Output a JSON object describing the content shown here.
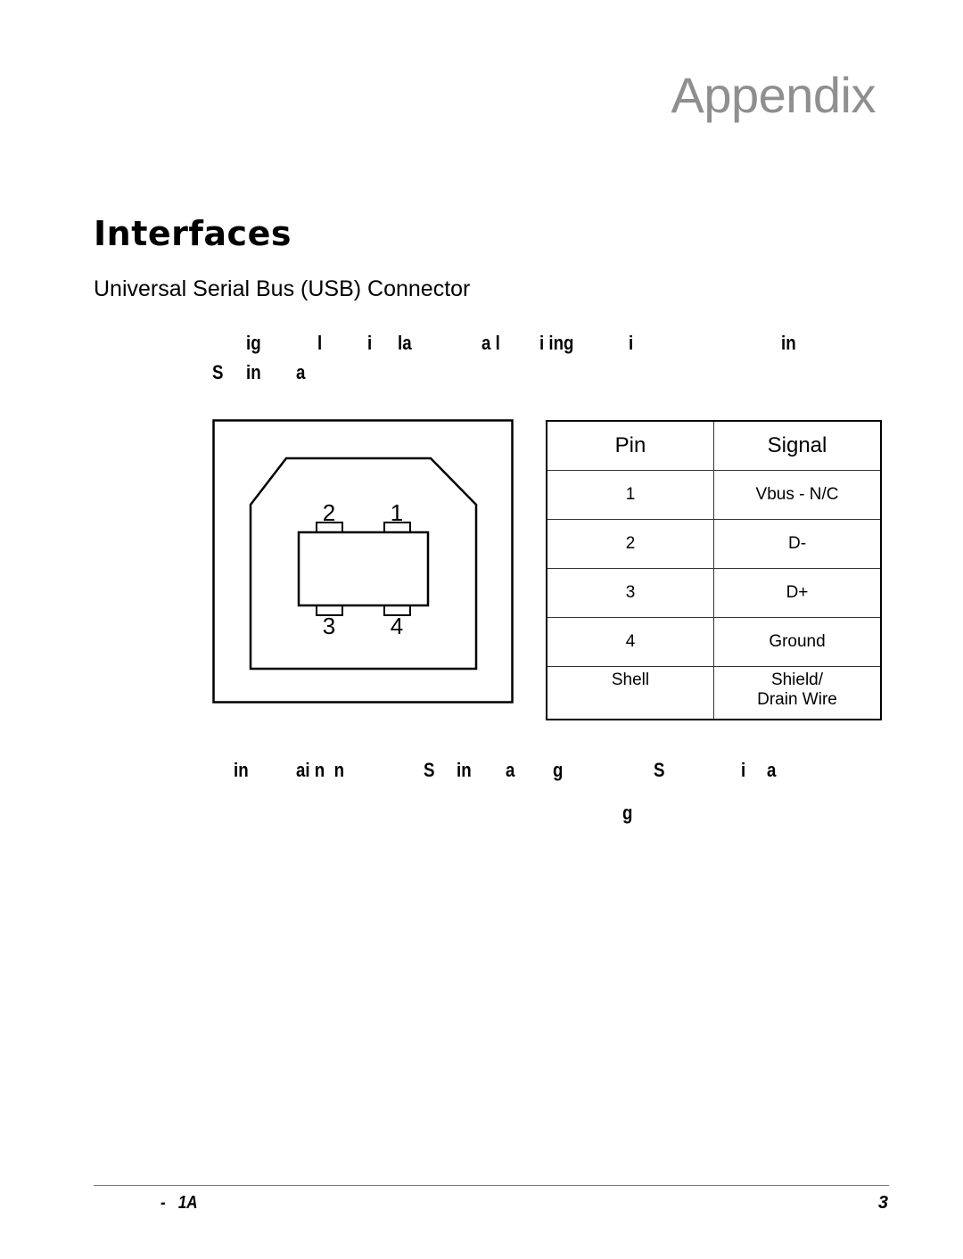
{
  "header": {
    "chapter_title": "Appendix"
  },
  "section": {
    "title": "Interfaces",
    "subtitle": "Universal Serial Bus (USB) Connector"
  },
  "intro_fragments": {
    "line1": [
      "ig",
      "l",
      "i",
      "la",
      "a l",
      "i ing",
      "i",
      "in"
    ],
    "line2": [
      "S",
      "in",
      "a"
    ]
  },
  "diagram": {
    "pin_labels": [
      "2",
      "1",
      "3",
      "4"
    ]
  },
  "pin_table": {
    "headers": [
      "Pin",
      "Signal"
    ],
    "rows": [
      {
        "pin": "1",
        "signal": "Vbus - N/C"
      },
      {
        "pin": "2",
        "signal": "D-"
      },
      {
        "pin": "3",
        "signal": "D+"
      },
      {
        "pin": "4",
        "signal": "Ground"
      },
      {
        "pin": "Shell",
        "signal_line1": "Shield/",
        "signal_line2": "Drain Wire"
      }
    ]
  },
  "note_fragments": {
    "line1": [
      "in",
      "ai n  n",
      "S",
      "in",
      "a",
      "g",
      "S",
      "i",
      "a"
    ],
    "line2": [
      "g"
    ]
  },
  "footer": {
    "left": "-   1A",
    "page_number": "3"
  }
}
